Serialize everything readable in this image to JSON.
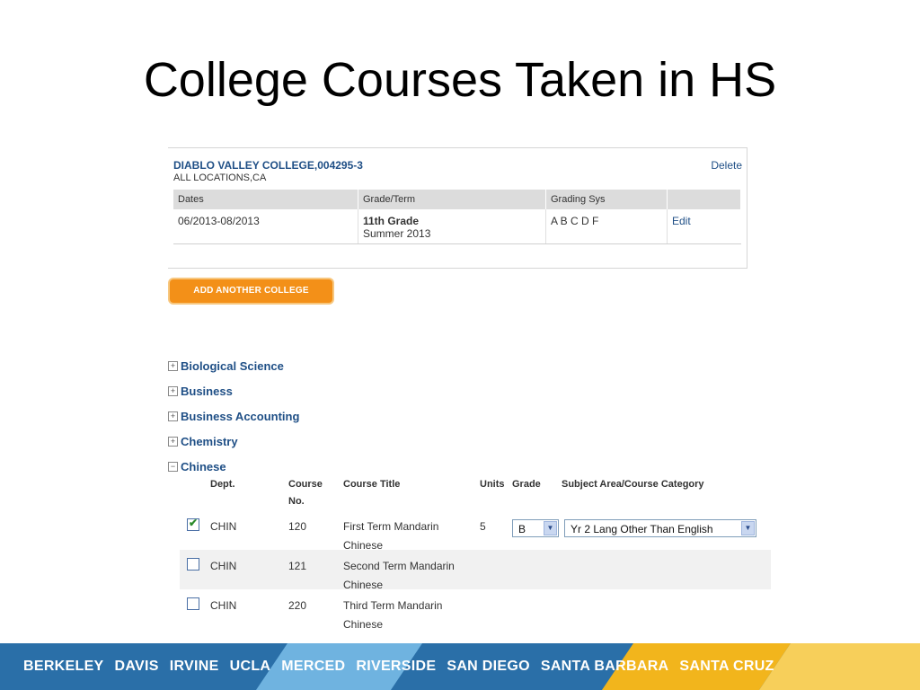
{
  "slide": {
    "title": "College Courses Taken in HS"
  },
  "college": {
    "name": "DIABLO VALLEY COLLEGE,004295-3",
    "location": "ALL LOCATIONS,CA",
    "delete_label": "Delete",
    "columns": [
      "Dates",
      "Grade/Term",
      "Grading Sys",
      ""
    ],
    "row": {
      "dates": "06/2013-08/2013",
      "grade": "11th Grade",
      "term": "Summer 2013",
      "grading_sys": "A B C D F",
      "edit_label": "Edit"
    }
  },
  "add_college_label": "ADD ANOTHER COLLEGE",
  "subjects": [
    {
      "toggle": "+",
      "label": "Biological Science"
    },
    {
      "toggle": "+",
      "label": "Business"
    },
    {
      "toggle": "+",
      "label": "Business Accounting"
    },
    {
      "toggle": "+",
      "label": "Chemistry"
    },
    {
      "toggle": "−",
      "label": "Chinese"
    }
  ],
  "courses": {
    "headers": {
      "dept": "Dept.",
      "course_no_line1": "Course",
      "course_no_line2": "No.",
      "title": "Course Title",
      "units": "Units",
      "grade": "Grade",
      "category": "Subject Area/Course Category"
    },
    "rows": [
      {
        "checked": true,
        "dept": "CHIN",
        "no": "120",
        "title_1": "First Term Mandarin",
        "title_2": "Chinese",
        "units": "5",
        "grade": "B",
        "category": "Yr 2 Lang Other Than English"
      },
      {
        "checked": false,
        "dept": "CHIN",
        "no": "121",
        "title_1": "Second Term Mandarin",
        "title_2": "Chinese",
        "units": "",
        "grade": "",
        "category": ""
      },
      {
        "checked": false,
        "dept": "CHIN",
        "no": "220",
        "title_1": "Third Term Mandarin",
        "title_2": "Chinese",
        "units": "",
        "grade": "",
        "category": ""
      }
    ]
  },
  "footer": {
    "campuses": [
      "BERKELEY",
      "DAVIS",
      "IRVINE",
      "UCLA",
      "MERCED",
      "RIVERSIDE",
      "SAN DIEGO",
      "SANTA BARBARA",
      "SANTA CRUZ"
    ],
    "colors": {
      "blue": "#2a6fa8",
      "light_blue": "#6fb3e0",
      "gold": "#f2b51c"
    }
  }
}
